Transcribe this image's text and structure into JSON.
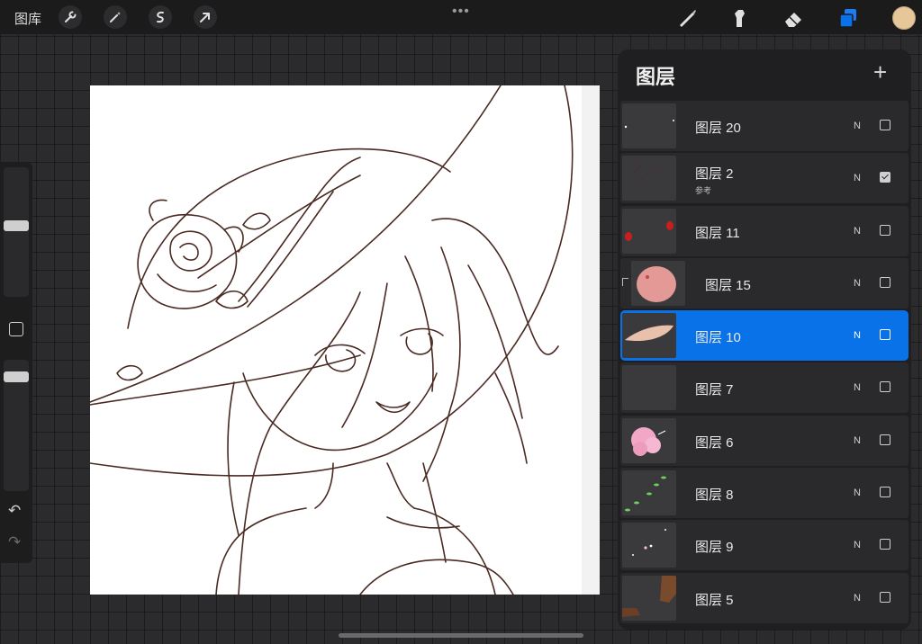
{
  "topbar": {
    "gallery_label": "图库",
    "left_tools": [
      "wrench-icon",
      "magic-wand-icon",
      "selection-icon",
      "transform-arrow-icon"
    ],
    "more_dots": "•••",
    "right_tools": [
      "brush-icon",
      "smudge-icon",
      "eraser-icon",
      "layers-icon"
    ],
    "active_tool": "layers-icon",
    "current_color": "#e6c79a"
  },
  "sidebar": {
    "undo_icon": "↶",
    "redo_icon": "↷",
    "brush_size": 0.55,
    "opacity": 0.9
  },
  "layers_panel": {
    "title": "图层",
    "add_icon": "+",
    "layers": [
      {
        "name": "图层 20",
        "blend": "N",
        "visible": false
      },
      {
        "name": "图层 2",
        "sub": "参考",
        "blend": "N",
        "visible": true
      },
      {
        "name": "图层 11",
        "blend": "N",
        "visible": false
      },
      {
        "name": "图层 15",
        "blend": "N",
        "visible": false,
        "clipped": true
      },
      {
        "name": "图层 10",
        "blend": "N",
        "visible": false,
        "selected": true
      },
      {
        "name": "图层 7",
        "blend": "N",
        "visible": false
      },
      {
        "name": "图层 6",
        "blend": "N",
        "visible": false
      },
      {
        "name": "图层 8",
        "blend": "N",
        "visible": false
      },
      {
        "name": "图层 9",
        "blend": "N",
        "visible": false
      },
      {
        "name": "图层 5",
        "blend": "N",
        "visible": false
      }
    ]
  }
}
